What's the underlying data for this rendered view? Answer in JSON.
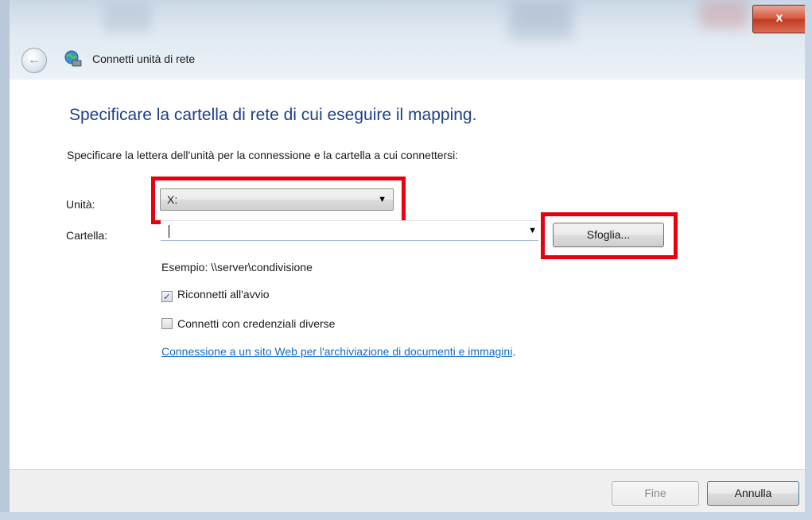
{
  "window": {
    "title": "Connetti unità di rete",
    "close_glyph": "x"
  },
  "nav": {
    "back_glyph": "←"
  },
  "main": {
    "heading": "Specificare la cartella di rete di cui eseguire il mapping.",
    "instruction": "Specificare la lettera dell'unità per la connessione e la cartella a cui connettersi:",
    "drive": {
      "label": "Unità:",
      "value": "X:"
    },
    "folder": {
      "label": "Cartella:",
      "value": "",
      "browse_label": "Sfoglia..."
    },
    "example": "Esempio: \\\\server\\condivisione",
    "reconnect": {
      "label": "Riconnetti all'avvio",
      "checked": true
    },
    "credentials": {
      "label": "Connetti con credenziali diverse",
      "checked": false
    },
    "link_text": "Connessione a un sito Web per l'archiviazione di documenti e immagini",
    "link_suffix": "."
  },
  "footer": {
    "finish_label": "Fine",
    "cancel_label": "Annulla"
  },
  "colors": {
    "heading": "#1e3f8a",
    "link": "#0f6fc6",
    "highlight": "#e8000f"
  },
  "icons": {
    "window_icon": "network-drive-icon",
    "dropdown": "dropdown-arrow-icon",
    "back": "back-arrow-icon",
    "close": "close-icon"
  }
}
